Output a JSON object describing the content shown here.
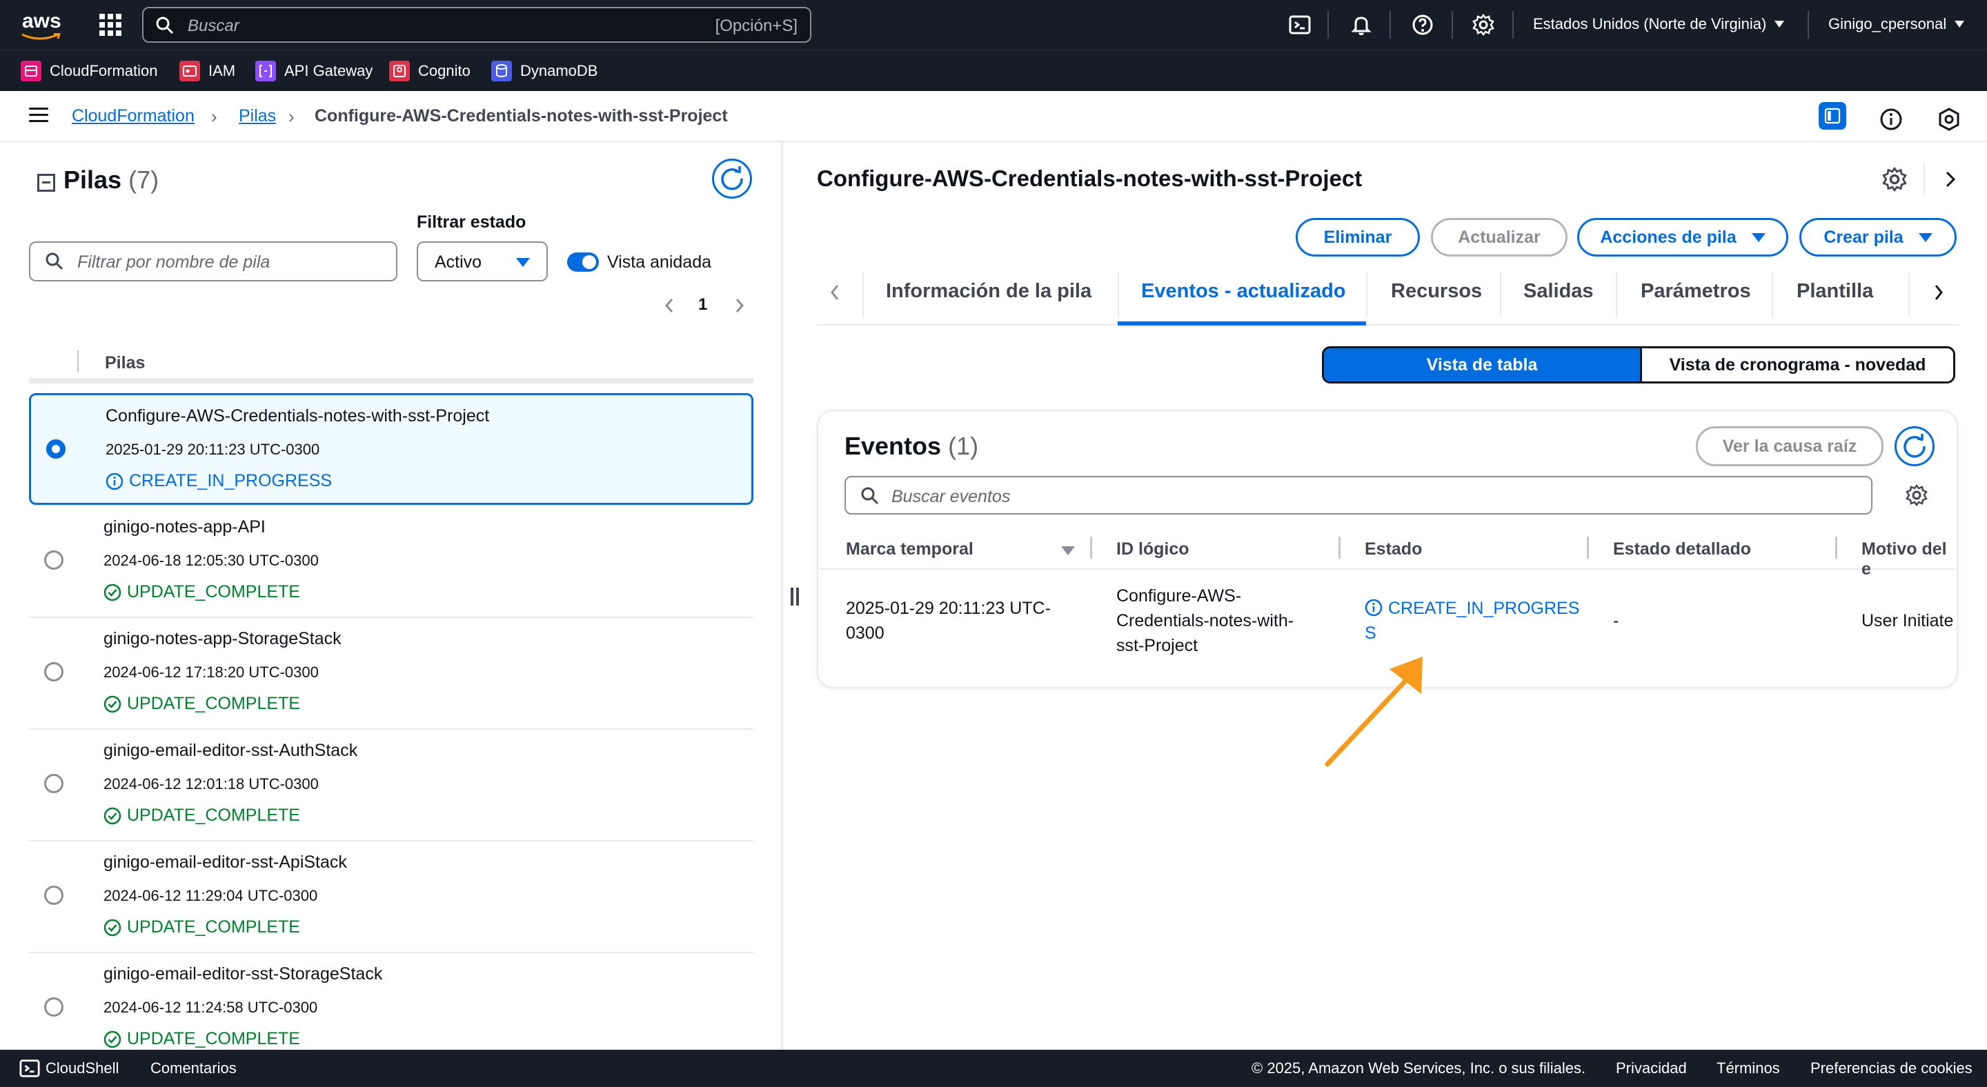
{
  "topnav": {
    "logo": "aws",
    "search_placeholder": "Buscar",
    "search_shortcut": "[Opción+S]",
    "region": "Estados Unidos (Norte de Virginia)",
    "user": "Ginigo_cpersonal",
    "icons": [
      "cloudshell-icon",
      "bell-icon",
      "help-icon",
      "gear-icon"
    ]
  },
  "favorites": [
    {
      "label": "CloudFormation",
      "color": "#e7157b"
    },
    {
      "label": "IAM",
      "color": "#dd344c"
    },
    {
      "label": "API Gateway",
      "color": "#8c4fff"
    },
    {
      "label": "Cognito",
      "color": "#dd344c"
    },
    {
      "label": "DynamoDB",
      "color": "#4b5ce8"
    }
  ],
  "breadcrumb": {
    "items": [
      "CloudFormation",
      "Pilas"
    ],
    "current": "Configure-AWS-Credentials-notes-with-sst-Project"
  },
  "left": {
    "title": "Pilas",
    "count": "(7)",
    "filter_placeholder": "Filtrar por nombre de pila",
    "filter_state_label": "Filtrar estado",
    "filter_state_value": "Activo",
    "nested_view_label": "Vista anidada",
    "nested_view_on": true,
    "page": "1",
    "column": "Pilas",
    "stacks": [
      {
        "name": "Configure-AWS-Credentials-notes-with-sst-Project",
        "date": "2025-01-29 20:11:23 UTC-0300",
        "status": "CREATE_IN_PROGRESS",
        "selected": true
      },
      {
        "name": "ginigo-notes-app-API",
        "date": "2024-06-18 12:05:30 UTC-0300",
        "status": "UPDATE_COMPLETE"
      },
      {
        "name": "ginigo-notes-app-StorageStack",
        "date": "2024-06-12 17:18:20 UTC-0300",
        "status": "UPDATE_COMPLETE"
      },
      {
        "name": "ginigo-email-editor-sst-AuthStack",
        "date": "2024-06-12 12:01:18 UTC-0300",
        "status": "UPDATE_COMPLETE"
      },
      {
        "name": "ginigo-email-editor-sst-ApiStack",
        "date": "2024-06-12 11:29:04 UTC-0300",
        "status": "UPDATE_COMPLETE"
      },
      {
        "name": "ginigo-email-editor-sst-StorageStack",
        "date": "2024-06-12 11:24:58 UTC-0300",
        "status": "UPDATE_COMPLETE"
      }
    ]
  },
  "right": {
    "title": "Configure-AWS-Credentials-notes-with-sst-Project",
    "buttons": {
      "delete": "Eliminar",
      "update": "Actualizar",
      "actions": "Acciones de pila",
      "create": "Crear pila"
    },
    "tabs": [
      "Información de la pila",
      "Eventos - actualizado",
      "Recursos",
      "Salidas",
      "Parámetros",
      "Plantilla"
    ],
    "active_tab": "Eventos - actualizado",
    "views": {
      "table": "Vista de tabla",
      "timeline": "Vista de cronograma - novedad"
    },
    "events": {
      "title": "Eventos",
      "count": "(1)",
      "root_cause": "Ver la causa raíz",
      "search_placeholder": "Buscar eventos",
      "columns": [
        "Marca temporal",
        "ID lógico",
        "Estado",
        "Estado detallado",
        "Motivo del e"
      ],
      "row": {
        "timestamp_line1": "2025-01-29 20:11:23 UTC-",
        "timestamp_line2": "0300",
        "logical_id_line1": "Configure-AWS-",
        "logical_id_line2": "Credentials-notes-with-",
        "logical_id_line3": "sst-Project",
        "status_line1": "CREATE_IN_PROGRES",
        "status_line2": "S",
        "detailed_status": "-",
        "reason": "User Initiate"
      }
    }
  },
  "footer": {
    "cloudshell": "CloudShell",
    "feedback": "Comentarios",
    "copyright": "© 2025, Amazon Web Services, Inc. o sus filiales.",
    "privacy": "Privacidad",
    "terms": "Términos",
    "cookies": "Preferencias de cookies"
  },
  "colors": {
    "accent": "#006ce0",
    "success": "#00802f",
    "nav_bg": "#161d26",
    "annotation_arrow": "#f89a1c"
  }
}
